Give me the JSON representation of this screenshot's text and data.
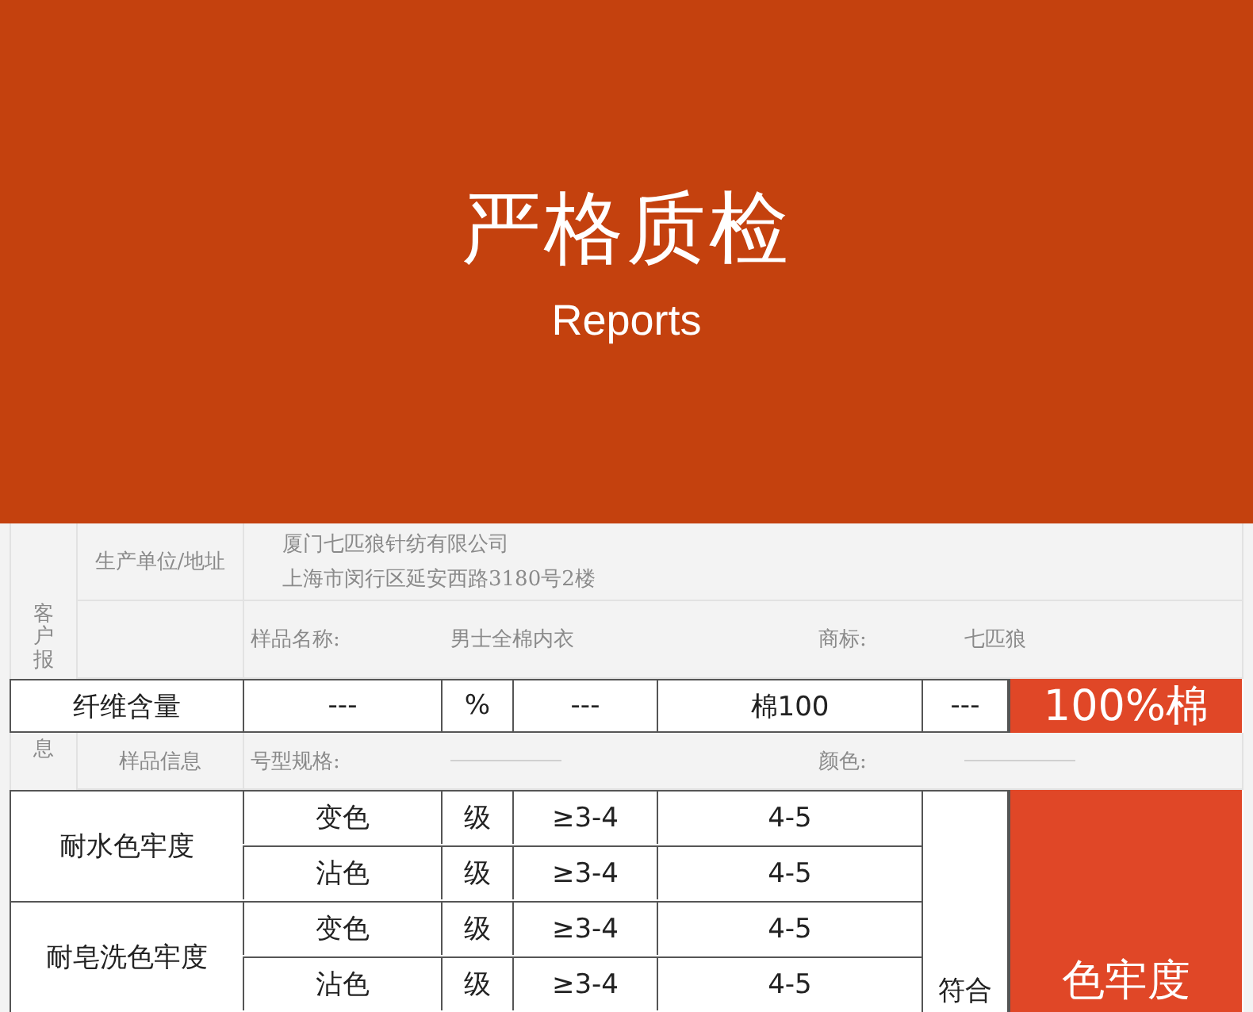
{
  "header": {
    "title": "严格质检",
    "subtitle": "Reports"
  },
  "background_form": {
    "side_label_top": "客户报",
    "side_label_bottom": "息",
    "producer": {
      "label": "生产单位/地址",
      "lines": [
        "厦门七匹狼针纺有限公司",
        "上海市闵行区延安西路3180号2楼"
      ]
    },
    "sample_name": {
      "label": "样品名称:",
      "value": "男士全棉内衣",
      "trademark_label": "商标:",
      "trademark": "七匹狼"
    },
    "sample_info": {
      "label": "样品信息",
      "size_label": "号型规格:",
      "color_label": "颜色:"
    }
  },
  "fiber_row": {
    "cells": [
      "纤维含量",
      "---",
      "%",
      "---",
      "棉100",
      "---"
    ],
    "badge": "100%棉"
  },
  "fastness": {
    "groups": [
      {
        "name": "耐水色牢度",
        "rows": [
          {
            "item": "变色",
            "unit": "级",
            "standard": "≥3-4",
            "result": "4-5"
          },
          {
            "item": "沾色",
            "unit": "级",
            "standard": "≥3-4",
            "result": "4-5"
          }
        ]
      },
      {
        "name": "耐皂洗色牢度",
        "rows": [
          {
            "item": "变色",
            "unit": "级",
            "standard": "≥3-4",
            "result": "4-5"
          },
          {
            "item": "沾色",
            "unit": "级",
            "standard": "≥3-4",
            "result": "4-5"
          }
        ]
      }
    ],
    "verdict": "符合",
    "badge": "色牢度"
  }
}
